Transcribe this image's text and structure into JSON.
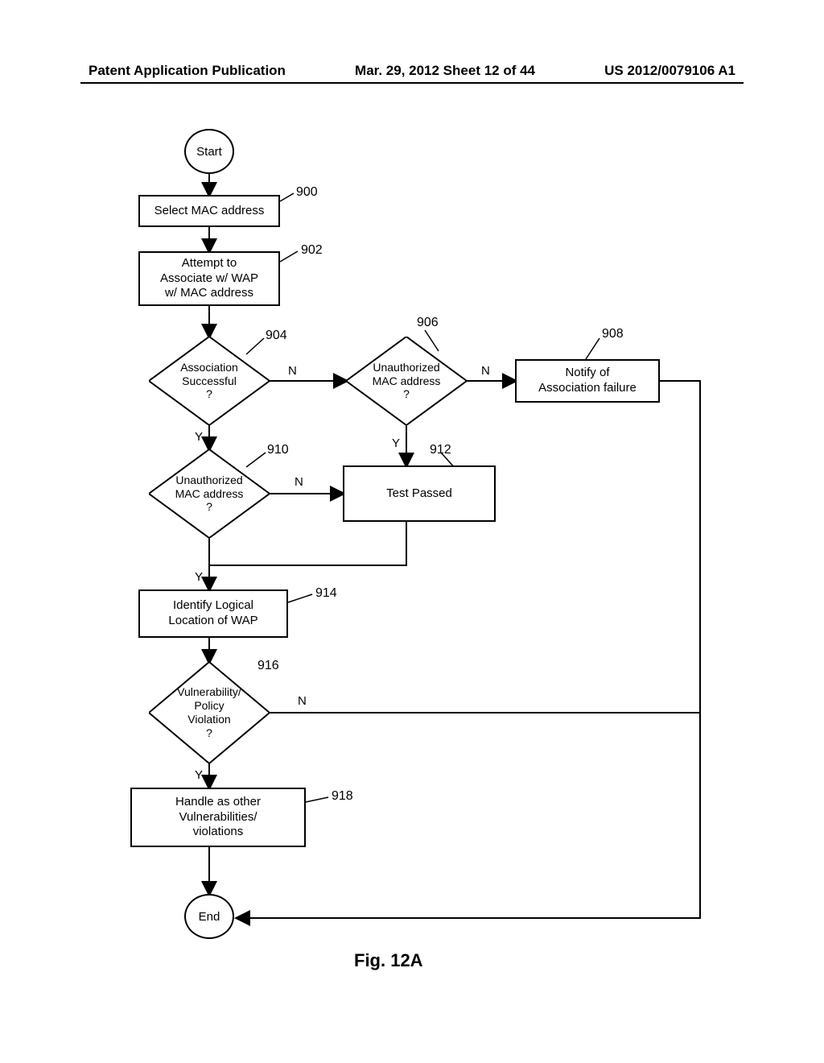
{
  "header": {
    "left": "Patent Application Publication",
    "mid": "Mar. 29, 2012  Sheet 12 of 44",
    "right": "US 2012/0079106 A1"
  },
  "figure_caption": "Fig. 12A",
  "nodes": {
    "start": "Start",
    "end": "End",
    "n900": "Select MAC address",
    "n902": "Attempt to\nAssociate w/ WAP\nw/ MAC address",
    "n904": "Association\nSuccessful\n?",
    "n906": "Unauthorized\nMAC address\n?",
    "n908": "Notify of\nAssociation failure",
    "n910": "Unauthorized\nMAC address\n?",
    "n912": "Test Passed",
    "n914": "Identify Logical\nLocation of WAP",
    "n916": "Vulnerability/\nPolicy\nViolation\n?",
    "n918": "Handle as other\nVulnerabilities/\nviolations"
  },
  "refs": {
    "r900": "900",
    "r902": "902",
    "r904": "904",
    "r906": "906",
    "r908": "908",
    "r910": "910",
    "r912": "912",
    "r914": "914",
    "r916": "916",
    "r918": "918"
  },
  "labels": {
    "Y": "Y",
    "N": "N"
  },
  "chart_data": {
    "type": "flowchart",
    "title": "Fig. 12A",
    "nodes": [
      {
        "id": "start",
        "type": "terminal",
        "label": "Start"
      },
      {
        "id": "900",
        "type": "process",
        "label": "Select MAC address"
      },
      {
        "id": "902",
        "type": "process",
        "label": "Attempt to Associate w/ WAP w/ MAC address"
      },
      {
        "id": "904",
        "type": "decision",
        "label": "Association Successful ?"
      },
      {
        "id": "906",
        "type": "decision",
        "label": "Unauthorized MAC address ?"
      },
      {
        "id": "908",
        "type": "process",
        "label": "Notify of Association failure"
      },
      {
        "id": "910",
        "type": "decision",
        "label": "Unauthorized MAC address ?"
      },
      {
        "id": "912",
        "type": "process",
        "label": "Test Passed"
      },
      {
        "id": "914",
        "type": "process",
        "label": "Identify Logical Location of WAP"
      },
      {
        "id": "916",
        "type": "decision",
        "label": "Vulnerability/ Policy Violation ?"
      },
      {
        "id": "918",
        "type": "process",
        "label": "Handle as other Vulnerabilities/ violations"
      },
      {
        "id": "end",
        "type": "terminal",
        "label": "End"
      }
    ],
    "edges": [
      {
        "from": "start",
        "to": "900"
      },
      {
        "from": "900",
        "to": "902"
      },
      {
        "from": "902",
        "to": "904"
      },
      {
        "from": "904",
        "to": "906",
        "label": "N"
      },
      {
        "from": "904",
        "to": "910",
        "label": "Y"
      },
      {
        "from": "906",
        "to": "908",
        "label": "N"
      },
      {
        "from": "906",
        "to": "912",
        "label": "Y"
      },
      {
        "from": "908",
        "to": "end"
      },
      {
        "from": "910",
        "to": "912",
        "label": "N"
      },
      {
        "from": "910",
        "to": "914",
        "label": "Y (via merge)"
      },
      {
        "from": "912",
        "to": "914",
        "label": "(merge)"
      },
      {
        "from": "914",
        "to": "916"
      },
      {
        "from": "916",
        "to": "end",
        "label": "N"
      },
      {
        "from": "916",
        "to": "918",
        "label": "Y"
      },
      {
        "from": "918",
        "to": "end"
      }
    ]
  }
}
